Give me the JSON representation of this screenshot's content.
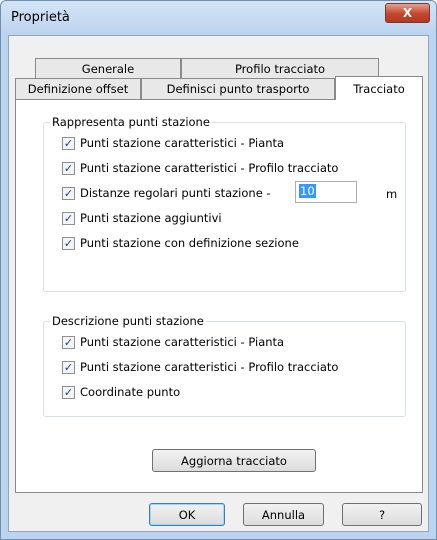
{
  "window": {
    "title": "Proprietà",
    "close_label": "X"
  },
  "tabs": {
    "row1": [
      {
        "label": "Generale"
      },
      {
        "label": "Profilo tracciato"
      }
    ],
    "row2": [
      {
        "label": "Definizione offset"
      },
      {
        "label": "Definisci punto trasporto"
      },
      {
        "label": "Tracciato",
        "active": true
      }
    ]
  },
  "group1": {
    "title": "Rappresenta punti stazione",
    "items": [
      {
        "label": "Punti stazione caratteristici - Pianta",
        "checked": true
      },
      {
        "label": "Punti stazione caratteristici - Profilo tracciato",
        "checked": true
      },
      {
        "label": "Distanze regolari punti stazione -",
        "checked": true
      },
      {
        "label": "Punti stazione aggiuntivi",
        "checked": true
      },
      {
        "label": "Punti stazione con definizione sezione",
        "checked": true
      }
    ],
    "distance_value": "10",
    "distance_unit": "m"
  },
  "group2": {
    "title": "Descrizione punti stazione",
    "items": [
      {
        "label": "Punti stazione caratteristici - Pianta",
        "checked": true
      },
      {
        "label": "Punti stazione caratteristici - Profilo tracciato",
        "checked": true
      },
      {
        "label": "Coordinate punto",
        "checked": true
      }
    ]
  },
  "update_button": "Aggiorna tracciato",
  "buttons": {
    "ok": "OK",
    "cancel": "Annulla",
    "help": "?"
  },
  "check_mark": "✓",
  "icons": {
    "close": "close-icon",
    "pointer": "mouse-pointer-icon"
  }
}
